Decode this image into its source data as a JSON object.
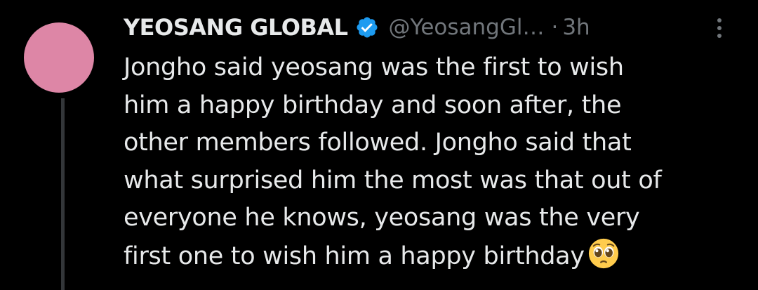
{
  "tweet": {
    "author": {
      "display_name": "YEOSANG GLOBAL",
      "handle": "@YeosangGl…",
      "verified": true,
      "avatar_color": "#dd86a6"
    },
    "separator": "·",
    "timestamp": "3h",
    "body_lines": [
      "Jongho said yeosang was the first to wish",
      "him a happy birthday and soon after, the",
      "other members followed. Jongho said that",
      "what surprised him the most was that out of",
      "everyone he knows, yeosang was the very",
      "first one to wish him a happy birthday"
    ],
    "emoji": "pleading-face-emoji",
    "icons": {
      "verified": "verified-badge-icon",
      "more": "more-options-icon"
    },
    "colors": {
      "background": "#000000",
      "text_primary": "#e7e9ea",
      "text_secondary": "#71767b",
      "verified_blue": "#1d9bf0",
      "thread_line": "#333639"
    }
  }
}
